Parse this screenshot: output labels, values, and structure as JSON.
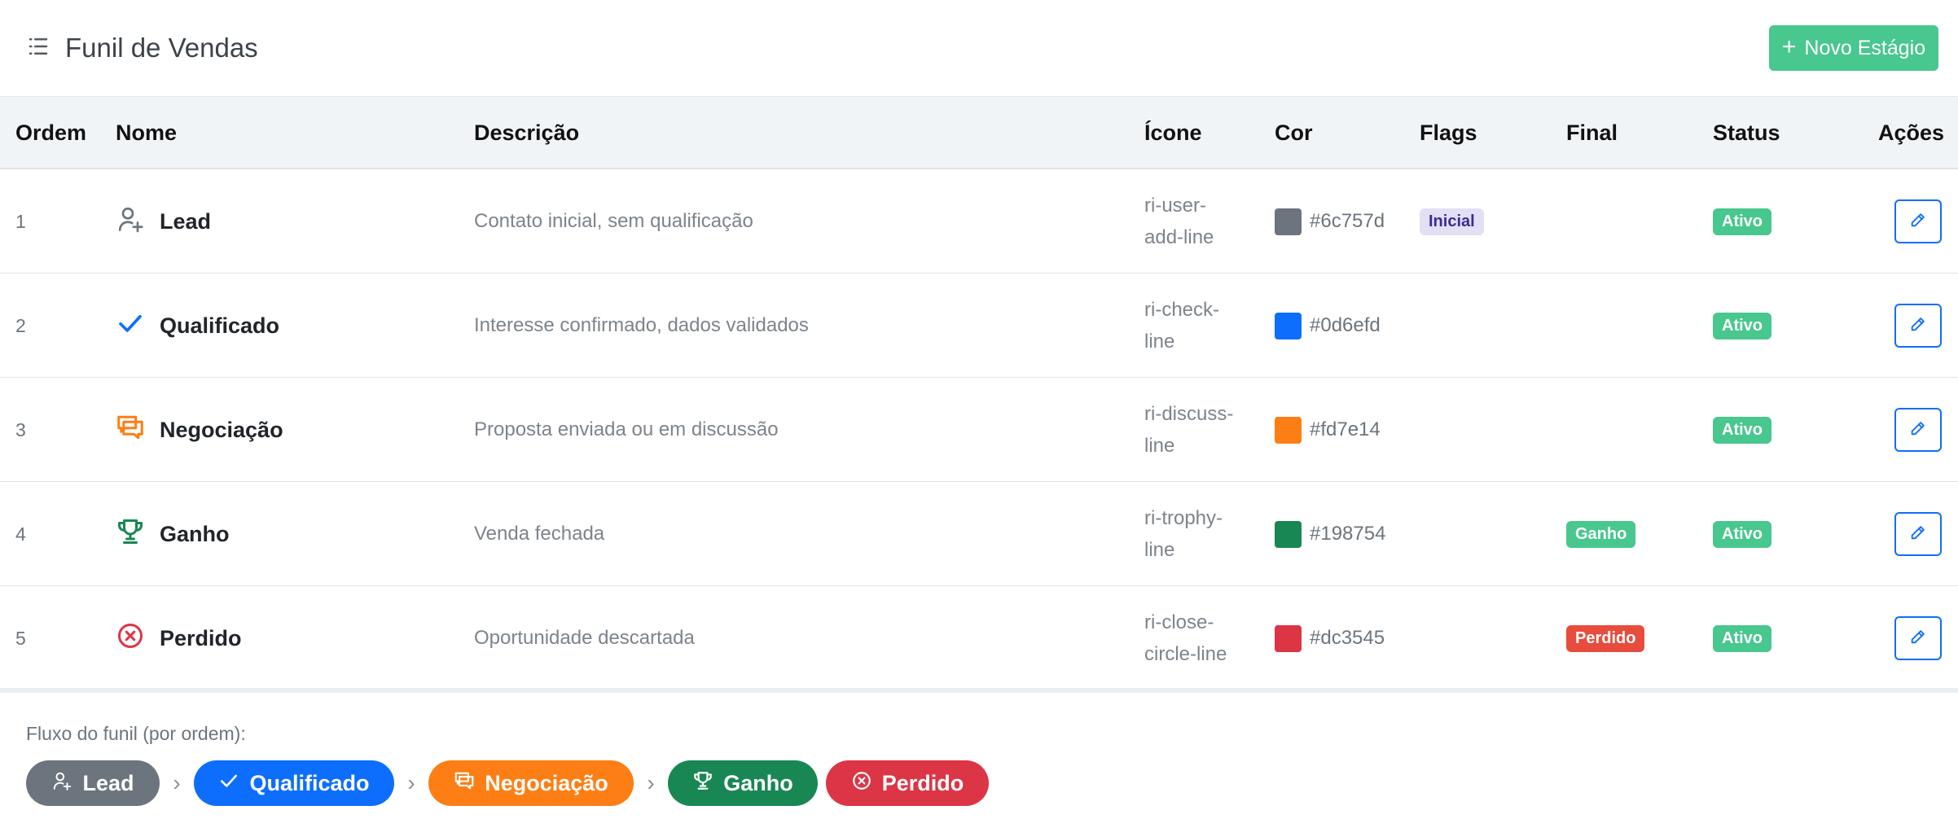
{
  "header": {
    "title": "Funil de Vendas",
    "new_button": "Novo Estágio"
  },
  "columns": [
    "Ordem",
    "Nome",
    "Descrição",
    "Ícone",
    "Cor",
    "Flags",
    "Final",
    "Status",
    "Ações"
  ],
  "stages": [
    {
      "order": "1",
      "name": "Lead",
      "description": "Contato inicial, sem qualificação",
      "icon_a": "ri-user-",
      "icon_b": "add-line",
      "icon": "user-add-icon",
      "color": "#6c757d",
      "flag": "Inicial",
      "final": "",
      "status": "Ativo"
    },
    {
      "order": "2",
      "name": "Qualificado",
      "description": "Interesse confirmado, dados validados",
      "icon_a": "ri-check-",
      "icon_b": "line",
      "icon": "check-icon",
      "color": "#0d6efd",
      "flag": "",
      "final": "",
      "status": "Ativo"
    },
    {
      "order": "3",
      "name": "Negociação",
      "description": "Proposta enviada ou em discussão",
      "icon_a": "ri-discuss-",
      "icon_b": "line",
      "icon": "discuss-icon",
      "color": "#fd7e14",
      "flag": "",
      "final": "",
      "status": "Ativo"
    },
    {
      "order": "4",
      "name": "Ganho",
      "description": "Venda fechada",
      "icon_a": "ri-trophy-",
      "icon_b": "line",
      "icon": "trophy-icon",
      "color": "#198754",
      "flag": "",
      "final": "Ganho",
      "status": "Ativo"
    },
    {
      "order": "5",
      "name": "Perdido",
      "description": "Oportunidade descartada",
      "icon_a": "ri-close-",
      "icon_b": "circle-line",
      "icon": "close-circle-icon",
      "color": "#dc3545",
      "flag": "",
      "final": "Perdido",
      "status": "Ativo"
    }
  ],
  "flow": {
    "label": "Fluxo do funil (por ordem):",
    "separator": "›",
    "steps": [
      "Lead",
      "Qualificado",
      "Negociação",
      "Ganho",
      "Perdido"
    ]
  },
  "colors": {
    "accent": "#48c78e",
    "edit": "#0d6efd",
    "header_bg": "#f1f4f7",
    "lost": "#e74c3c"
  }
}
